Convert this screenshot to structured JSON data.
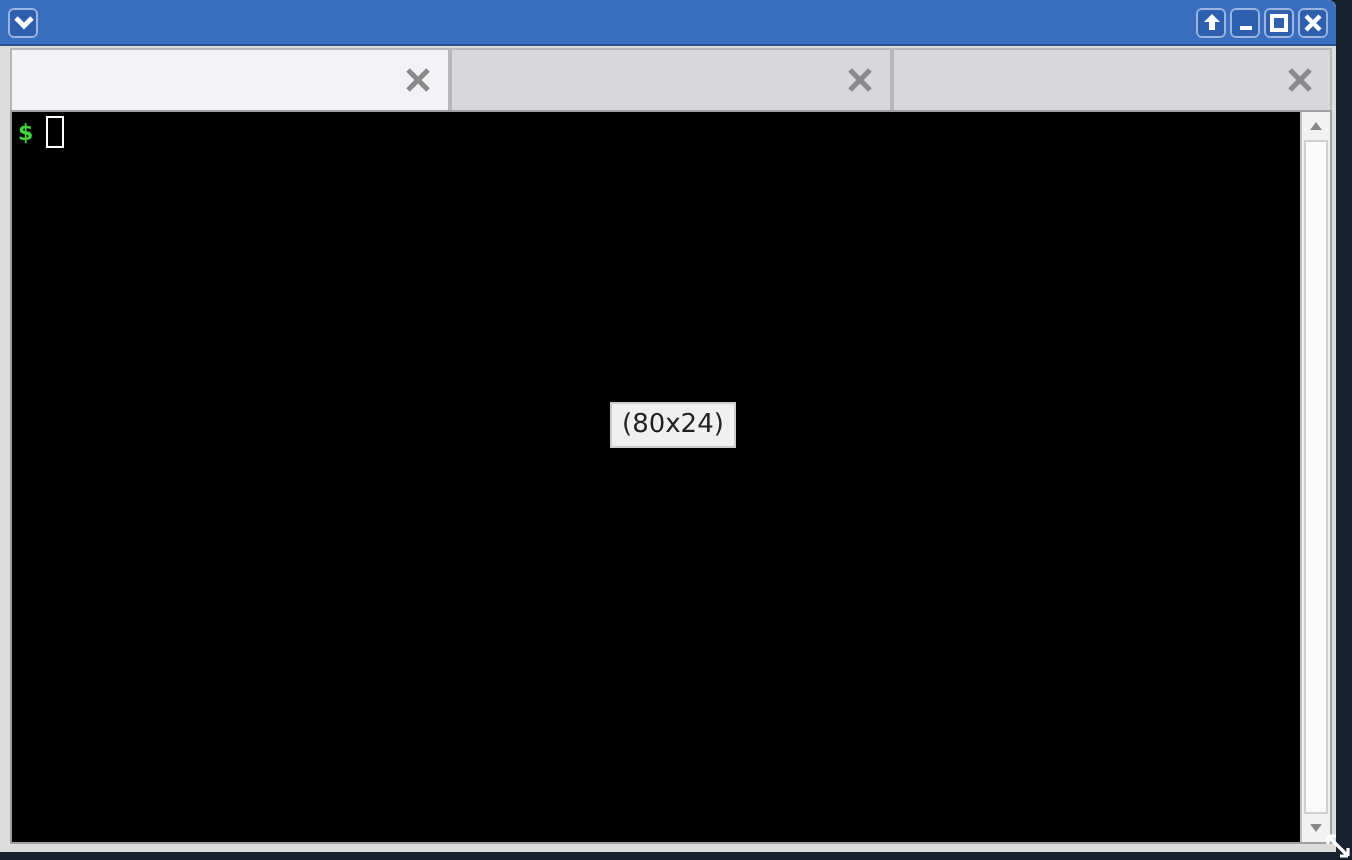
{
  "tabs": [
    {
      "selected": true
    },
    {
      "selected": false
    },
    {
      "selected": false
    }
  ],
  "terminal": {
    "prompt": "$",
    "size_label": "(80x24)"
  }
}
